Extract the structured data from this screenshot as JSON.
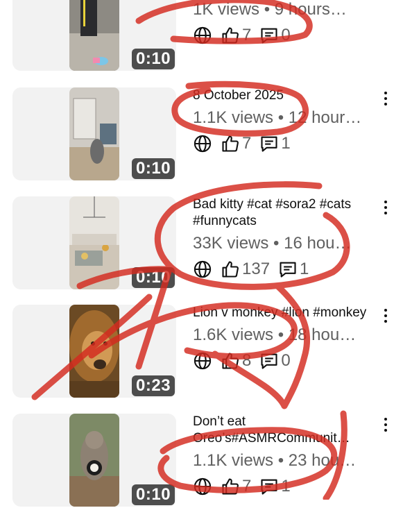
{
  "videos": [
    {
      "title": "",
      "views": "1K views • 9 hours…",
      "likes": "7",
      "comments": "0",
      "duration": "0:10",
      "visibility_icon": "globe-icon"
    },
    {
      "title": "8 October 2025",
      "views": "1.1K views • 12 hour…",
      "likes": "7",
      "comments": "1",
      "duration": "0:10",
      "visibility_icon": "globe-icon"
    },
    {
      "title": "Bad kitty #cat #sora2 #cats #funnycats",
      "views": "33K views • 16 hou…",
      "likes": "137",
      "comments": "1",
      "duration": "0:10",
      "visibility_icon": "globe-icon"
    },
    {
      "title": "Lion v monkey #lion #monkey",
      "views": "1.6K views • 18 hou…",
      "likes": "8",
      "comments": "0",
      "duration": "0:23",
      "visibility_icon": "globe-icon"
    },
    {
      "title": "Don’t eat Oreo’s#ASMRCommunit…",
      "views": "1.1K views • 23 hou…",
      "likes": "7",
      "comments": "1",
      "duration": "0:10",
      "visibility_icon": "globe-icon"
    }
  ],
  "colors": {
    "annotation_red": "#d42a1f",
    "card_bg": "#f2f2f2",
    "meta_text": "#606060"
  }
}
